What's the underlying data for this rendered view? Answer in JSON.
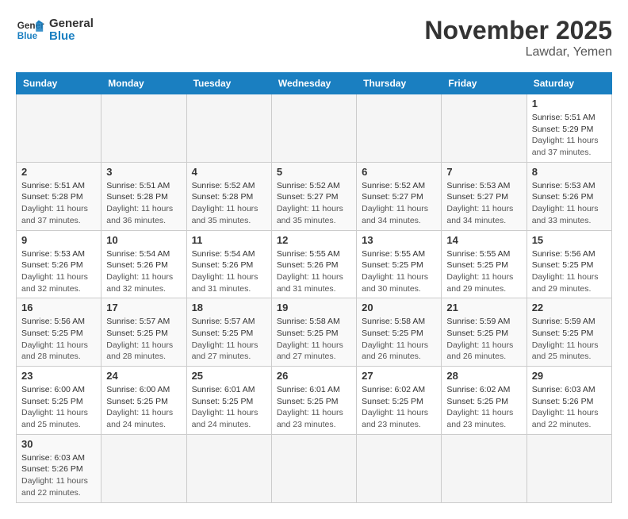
{
  "header": {
    "logo_general": "General",
    "logo_blue": "Blue",
    "month_title": "November 2025",
    "location": "Lawdar, Yemen"
  },
  "days_of_week": [
    "Sunday",
    "Monday",
    "Tuesday",
    "Wednesday",
    "Thursday",
    "Friday",
    "Saturday"
  ],
  "weeks": [
    [
      {
        "day": "",
        "info": ""
      },
      {
        "day": "",
        "info": ""
      },
      {
        "day": "",
        "info": ""
      },
      {
        "day": "",
        "info": ""
      },
      {
        "day": "",
        "info": ""
      },
      {
        "day": "",
        "info": ""
      },
      {
        "day": "1",
        "info": "Sunrise: 5:51 AM\nSunset: 5:29 PM\nDaylight: 11 hours and 37 minutes."
      }
    ],
    [
      {
        "day": "2",
        "info": "Sunrise: 5:51 AM\nSunset: 5:28 PM\nDaylight: 11 hours and 37 minutes."
      },
      {
        "day": "3",
        "info": "Sunrise: 5:51 AM\nSunset: 5:28 PM\nDaylight: 11 hours and 36 minutes."
      },
      {
        "day": "4",
        "info": "Sunrise: 5:52 AM\nSunset: 5:28 PM\nDaylight: 11 hours and 35 minutes."
      },
      {
        "day": "5",
        "info": "Sunrise: 5:52 AM\nSunset: 5:27 PM\nDaylight: 11 hours and 35 minutes."
      },
      {
        "day": "6",
        "info": "Sunrise: 5:52 AM\nSunset: 5:27 PM\nDaylight: 11 hours and 34 minutes."
      },
      {
        "day": "7",
        "info": "Sunrise: 5:53 AM\nSunset: 5:27 PM\nDaylight: 11 hours and 34 minutes."
      },
      {
        "day": "8",
        "info": "Sunrise: 5:53 AM\nSunset: 5:26 PM\nDaylight: 11 hours and 33 minutes."
      }
    ],
    [
      {
        "day": "9",
        "info": "Sunrise: 5:53 AM\nSunset: 5:26 PM\nDaylight: 11 hours and 32 minutes."
      },
      {
        "day": "10",
        "info": "Sunrise: 5:54 AM\nSunset: 5:26 PM\nDaylight: 11 hours and 32 minutes."
      },
      {
        "day": "11",
        "info": "Sunrise: 5:54 AM\nSunset: 5:26 PM\nDaylight: 11 hours and 31 minutes."
      },
      {
        "day": "12",
        "info": "Sunrise: 5:55 AM\nSunset: 5:26 PM\nDaylight: 11 hours and 31 minutes."
      },
      {
        "day": "13",
        "info": "Sunrise: 5:55 AM\nSunset: 5:25 PM\nDaylight: 11 hours and 30 minutes."
      },
      {
        "day": "14",
        "info": "Sunrise: 5:55 AM\nSunset: 5:25 PM\nDaylight: 11 hours and 29 minutes."
      },
      {
        "day": "15",
        "info": "Sunrise: 5:56 AM\nSunset: 5:25 PM\nDaylight: 11 hours and 29 minutes."
      }
    ],
    [
      {
        "day": "16",
        "info": "Sunrise: 5:56 AM\nSunset: 5:25 PM\nDaylight: 11 hours and 28 minutes."
      },
      {
        "day": "17",
        "info": "Sunrise: 5:57 AM\nSunset: 5:25 PM\nDaylight: 11 hours and 28 minutes."
      },
      {
        "day": "18",
        "info": "Sunrise: 5:57 AM\nSunset: 5:25 PM\nDaylight: 11 hours and 27 minutes."
      },
      {
        "day": "19",
        "info": "Sunrise: 5:58 AM\nSunset: 5:25 PM\nDaylight: 11 hours and 27 minutes."
      },
      {
        "day": "20",
        "info": "Sunrise: 5:58 AM\nSunset: 5:25 PM\nDaylight: 11 hours and 26 minutes."
      },
      {
        "day": "21",
        "info": "Sunrise: 5:59 AM\nSunset: 5:25 PM\nDaylight: 11 hours and 26 minutes."
      },
      {
        "day": "22",
        "info": "Sunrise: 5:59 AM\nSunset: 5:25 PM\nDaylight: 11 hours and 25 minutes."
      }
    ],
    [
      {
        "day": "23",
        "info": "Sunrise: 6:00 AM\nSunset: 5:25 PM\nDaylight: 11 hours and 25 minutes."
      },
      {
        "day": "24",
        "info": "Sunrise: 6:00 AM\nSunset: 5:25 PM\nDaylight: 11 hours and 24 minutes."
      },
      {
        "day": "25",
        "info": "Sunrise: 6:01 AM\nSunset: 5:25 PM\nDaylight: 11 hours and 24 minutes."
      },
      {
        "day": "26",
        "info": "Sunrise: 6:01 AM\nSunset: 5:25 PM\nDaylight: 11 hours and 23 minutes."
      },
      {
        "day": "27",
        "info": "Sunrise: 6:02 AM\nSunset: 5:25 PM\nDaylight: 11 hours and 23 minutes."
      },
      {
        "day": "28",
        "info": "Sunrise: 6:02 AM\nSunset: 5:25 PM\nDaylight: 11 hours and 23 minutes."
      },
      {
        "day": "29",
        "info": "Sunrise: 6:03 AM\nSunset: 5:26 PM\nDaylight: 11 hours and 22 minutes."
      }
    ],
    [
      {
        "day": "30",
        "info": "Sunrise: 6:03 AM\nSunset: 5:26 PM\nDaylight: 11 hours and 22 minutes."
      },
      {
        "day": "",
        "info": ""
      },
      {
        "day": "",
        "info": ""
      },
      {
        "day": "",
        "info": ""
      },
      {
        "day": "",
        "info": ""
      },
      {
        "day": "",
        "info": ""
      },
      {
        "day": "",
        "info": ""
      }
    ]
  ]
}
